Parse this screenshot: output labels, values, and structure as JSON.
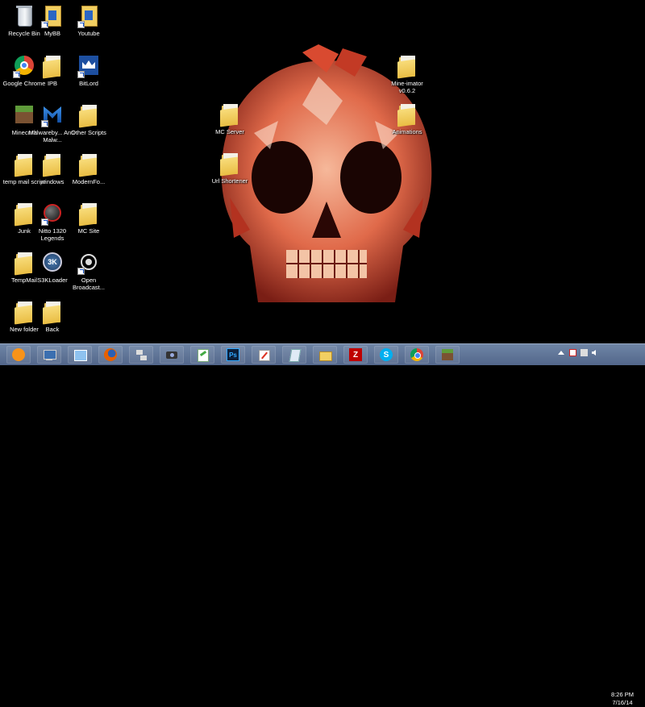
{
  "desktop": {
    "icons": [
      {
        "label": "Recycle Bin"
      },
      {
        "label": "MyBB"
      },
      {
        "label": "Youtube"
      },
      {
        "label": "Google Chrome"
      },
      {
        "label": "IPB"
      },
      {
        "label": "BitLord"
      },
      {
        "label": "Minecraft"
      },
      {
        "label": "Malwareby... Anti-Malw..."
      },
      {
        "label": "Other Scripts"
      },
      {
        "label": "temp mail script"
      },
      {
        "label": "windows"
      },
      {
        "label": "ModernFo..."
      },
      {
        "label": "Junk"
      },
      {
        "label": "Nitto 1320 Legends"
      },
      {
        "label": "MC Site"
      },
      {
        "label": "TempMail"
      },
      {
        "label": "S3KLoader"
      },
      {
        "label": "Open Broadcast..."
      },
      {
        "label": "New folder"
      },
      {
        "label": "Back"
      },
      {
        "label": "MC Server"
      },
      {
        "label": "Url Shortener"
      },
      {
        "label": "Mine-imator v0.6.2"
      },
      {
        "label": "Animations"
      }
    ]
  },
  "taskbar": {
    "pinned": [
      {
        "icon": "bitcoin-icon"
      },
      {
        "icon": "computer-icon"
      },
      {
        "icon": "control-panel-icon"
      },
      {
        "icon": "firefox-icon"
      },
      {
        "icon": "network-icon"
      },
      {
        "icon": "camera-icon"
      },
      {
        "icon": "notepad-plus-icon"
      },
      {
        "icon": "photoshop-icon"
      },
      {
        "icon": "paint-icon"
      },
      {
        "icon": "document-icon"
      },
      {
        "icon": "file-explorer-icon"
      },
      {
        "icon": "filezilla-icon"
      },
      {
        "icon": "skype-icon"
      },
      {
        "icon": "chrome-icon"
      },
      {
        "icon": "minecraft-icon"
      }
    ],
    "clock": {
      "time": "8:26 PM",
      "date": "7/16/14"
    },
    "photoshop_label": "Ps",
    "mc_label": "3K"
  },
  "colors": {
    "taskbar": "#5a6f93",
    "desktop_bg": "#000000",
    "folder": "#f2cf62"
  }
}
